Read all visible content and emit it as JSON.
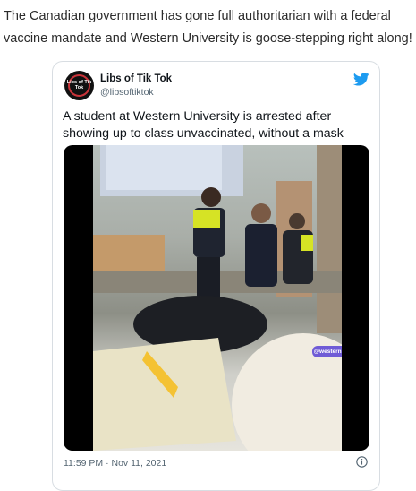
{
  "post": {
    "text": "The Canadian government has gone full authoritarian with a federal vaccine mandate and Western University is goose-stepping right along!"
  },
  "tweet": {
    "avatar_text": "Libs of Tik Tok",
    "display_name": "Libs of Tik Tok",
    "handle": "@libsoftiktok",
    "text": "A student at Western University is arrested after showing up to class unvaccinated, without a mask",
    "media_watermark": "@westernsavages",
    "timestamp": "11:59 PM · Nov 11, 2021",
    "brand_icon": "twitter-bird-icon",
    "info_icon": "info-icon",
    "colors": {
      "twitter_blue": "#1d9bf0",
      "avatar_ring": "#c9343a",
      "watermark_bg": "#6f5bd6"
    }
  }
}
